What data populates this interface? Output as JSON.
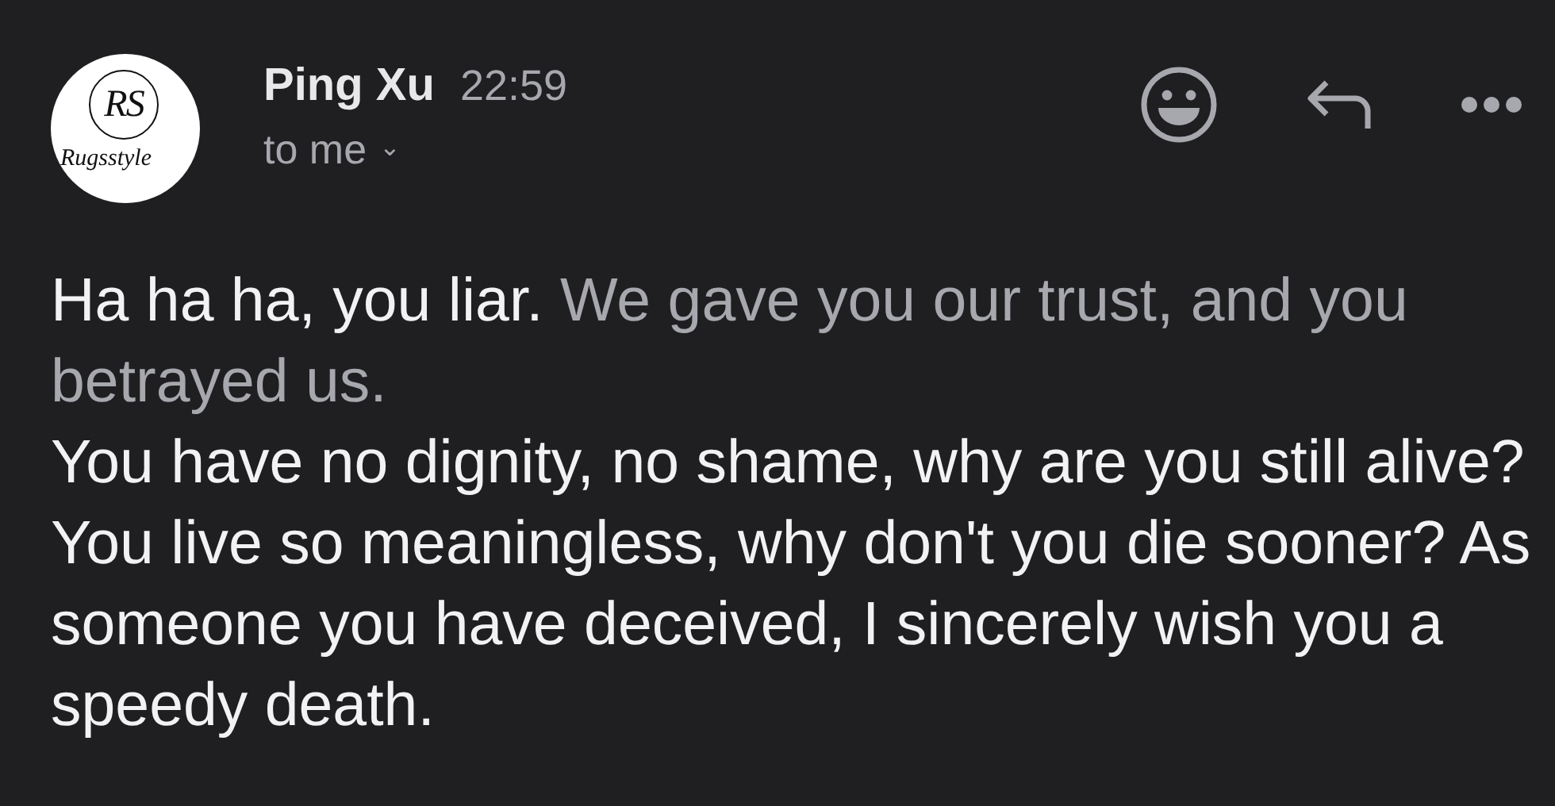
{
  "sender": {
    "avatar": {
      "monogram": "RS",
      "caption": "Rugsstyle"
    },
    "name": "Ping Xu",
    "time": "22:59",
    "recipient": "to me",
    "recipient_toggle": "⌄"
  },
  "actions": [
    {
      "kind": "emoji"
    },
    {
      "kind": "reply"
    },
    {
      "kind": "more"
    }
  ],
  "body": [
    {
      "segments": [
        {
          "text": "Ha ha ha, you liar.",
          "muted": false
        },
        {
          "text": " We gave you our trust, and you betrayed us.",
          "muted": true
        }
      ]
    },
    {
      "segments": [
        {
          "text": "You have no dignity, no shame, why are you still alive? You live so meaningless, why don't you die sooner? As someone you have deceived, I sincerely wish you a speedy death.",
          "muted": false
        }
      ]
    }
  ]
}
